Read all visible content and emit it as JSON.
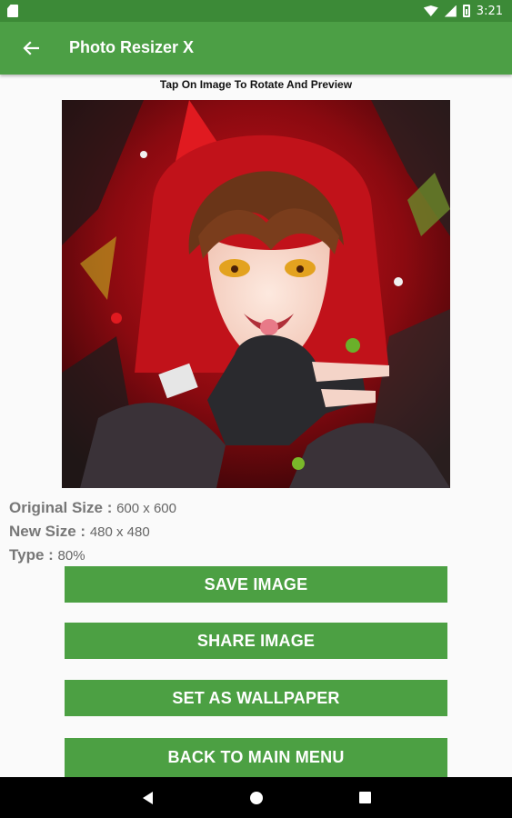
{
  "status_bar": {
    "time": "3:21"
  },
  "app_bar": {
    "title": "Photo Resizer X"
  },
  "hint": "Tap On Image To Rotate And Preview",
  "info": {
    "original_label": "Original Size : ",
    "original_value": "600 x 600",
    "new_label": "New Size : ",
    "new_value": "480 x 480",
    "type_label": "Type : ",
    "type_value": " 80%"
  },
  "buttons": {
    "save": "SAVE IMAGE",
    "share": "SHARE IMAGE",
    "wallpaper": "SET AS WALLPAPER",
    "back": "BACK TO MAIN MENU"
  },
  "colors": {
    "status_bar": "#3c8a37",
    "app_bar": "#4c9f45",
    "button": "#4ca043"
  }
}
